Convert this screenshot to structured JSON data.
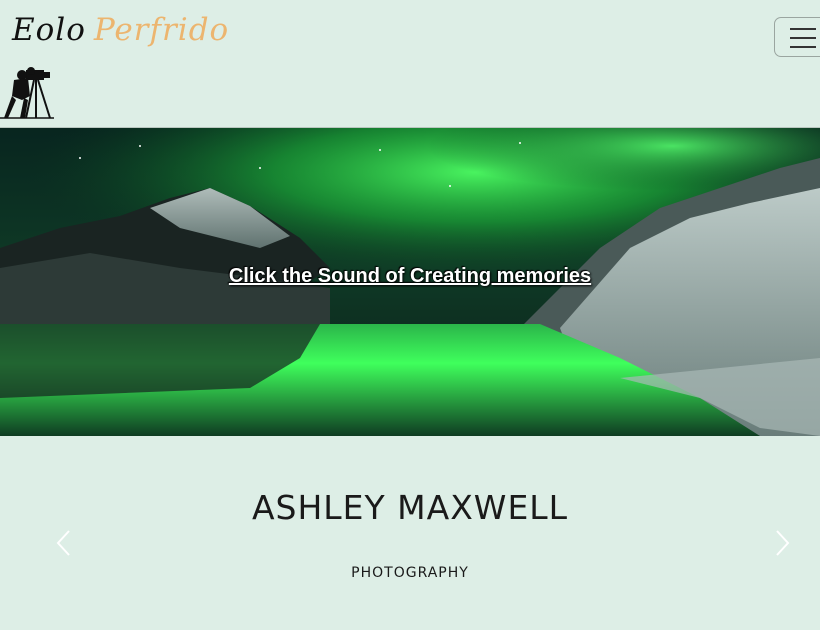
{
  "navbar": {
    "brand_first": "Eolo",
    "brand_second": "Perfrido",
    "logo_icon": "photographer-camera-silhouette-icon",
    "toggle_icon": "hamburger-menu-icon"
  },
  "hero": {
    "link_text": "Click the Sound of Creating memories"
  },
  "intro": {
    "name": "ASHLEY MAXWELL",
    "subtitle": "PHOTOGRAPHY",
    "prev_icon": "chevron-left-icon",
    "next_icon": "chevron-right-icon"
  },
  "colors": {
    "page_background": "#ddeee6",
    "brand_accent": "#ecb56f",
    "aurora_green": "#3cff5a"
  }
}
